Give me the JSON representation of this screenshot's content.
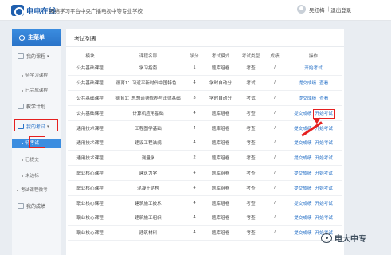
{
  "header": {
    "logo_text": "电电在线",
    "site_name": "网络学习平台",
    "site_sub": "中央广播电视中等专业学校",
    "user_name": "吴红梅",
    "separator": "|",
    "logout": "退出登录"
  },
  "sidebar": {
    "menu_title": "主菜单",
    "items": [
      {
        "label": "我的课程",
        "caret": "▾"
      },
      {
        "label": "待学习课程"
      },
      {
        "label": "已完成课程"
      },
      {
        "label": "教学计划"
      },
      {
        "label": "我的考试",
        "caret": "▾"
      },
      {
        "label": "待考试"
      },
      {
        "label": "已提交"
      },
      {
        "label": "未达标"
      },
      {
        "label": "考试课程微考"
      },
      {
        "label": "我的成绩"
      }
    ]
  },
  "main": {
    "title": "考试列表",
    "columns": [
      "模块",
      "课程名称",
      "学分",
      "考试模式",
      "考试类型",
      "成绩",
      "操作"
    ],
    "rows": [
      {
        "module": "公共基础课程",
        "course": "学习指南",
        "credit": "1",
        "mode": "题库组卷",
        "type": "考查",
        "score": "/",
        "ops": [
          "开始考试"
        ]
      },
      {
        "module": "公共基础课程",
        "course": "德育1：习近平新时代中国特色...",
        "credit": "4",
        "mode": "学时自动分",
        "type": "考试",
        "score": "/",
        "ops": [
          "提交成绩",
          "查看"
        ]
      },
      {
        "module": "公共基础课程",
        "course": "德育1：思想道德修养与法律基础",
        "credit": "3",
        "mode": "学时自动分",
        "type": "考试",
        "score": "/",
        "ops": [
          "提交成绩",
          "查看"
        ]
      },
      {
        "module": "公共基础课程",
        "course": "计算机应用基础",
        "credit": "4",
        "mode": "题库组卷",
        "type": "考查",
        "score": "/",
        "ops": [
          "提交成绩",
          "开始考试"
        ]
      },
      {
        "module": "通用技术课程",
        "course": "工程图学基础",
        "credit": "4",
        "mode": "题库组卷",
        "type": "考查",
        "score": "/",
        "ops": [
          "提交成绩",
          "开始考试"
        ]
      },
      {
        "module": "通用技术课程",
        "course": "建设工程法规",
        "credit": "4",
        "mode": "题库组卷",
        "type": "考查",
        "score": "/",
        "ops": [
          "提交成绩",
          "开始考试"
        ]
      },
      {
        "module": "通用技术课程",
        "course": "测量学",
        "credit": "2",
        "mode": "题库组卷",
        "type": "考查",
        "score": "/",
        "ops": [
          "提交成绩",
          "开始考试"
        ]
      },
      {
        "module": "职业核心课程",
        "course": "建筑力学",
        "credit": "4",
        "mode": "题库组卷",
        "type": "考查",
        "score": "/",
        "ops": [
          "提交成绩",
          "开始考试"
        ]
      },
      {
        "module": "职业核心课程",
        "course": "混凝土结构",
        "credit": "4",
        "mode": "题库组卷",
        "type": "考查",
        "score": "/",
        "ops": [
          "提交成绩",
          "开始考试"
        ]
      },
      {
        "module": "职业核心课程",
        "course": "建筑施工技术",
        "credit": "4",
        "mode": "题库组卷",
        "type": "考查",
        "score": "/",
        "ops": [
          "提交成绩",
          "开始考试"
        ]
      },
      {
        "module": "职业核心课程",
        "course": "建筑施工组织",
        "credit": "4",
        "mode": "题库组卷",
        "type": "考查",
        "score": "/",
        "ops": [
          "提交成绩",
          "开始考试"
        ]
      },
      {
        "module": "职业核心课程",
        "course": "建筑材料",
        "credit": "4",
        "mode": "题库组卷",
        "type": "考查",
        "score": "/",
        "ops": [
          "提交成绩",
          "开始考试"
        ]
      }
    ]
  },
  "watermark": {
    "text": "电大中专"
  },
  "colors": {
    "accent": "#2a73c8",
    "highlight": "#e52020",
    "header_blue": "#3b8de0"
  }
}
